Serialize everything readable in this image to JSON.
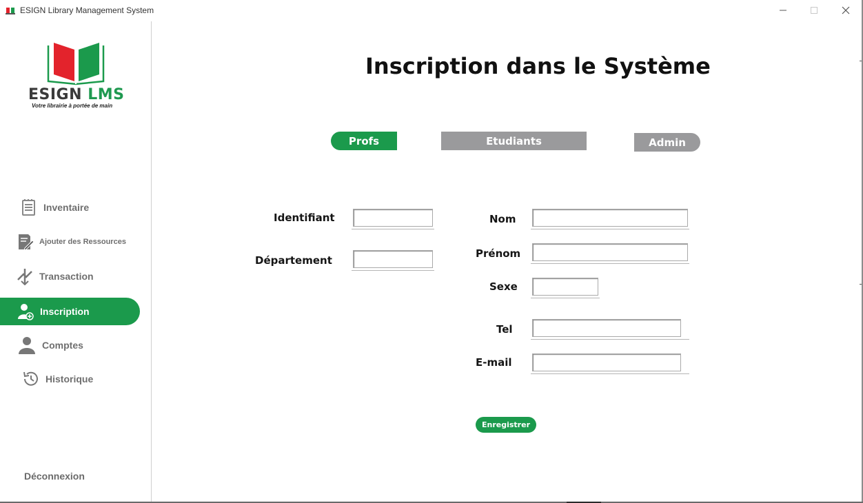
{
  "window": {
    "title": "ESIGN Library Management System"
  },
  "brand": {
    "name_part1": "ESIGN",
    "name_part2": "LMS",
    "tagline": "Votre librairie à portée de main",
    "colors": {
      "green": "#1b9a4c",
      "red": "#e3232c",
      "gray": "#3a3a3a"
    }
  },
  "sidebar": {
    "items": [
      {
        "label": "Inventaire",
        "icon": "document-list-icon",
        "active": false
      },
      {
        "label": "Ajouter des Ressources",
        "icon": "edit-document-icon",
        "active": false
      },
      {
        "label": "Transaction",
        "icon": "transfer-arrows-icon",
        "active": false
      },
      {
        "label": "Inscription",
        "icon": "add-user-icon",
        "active": true
      },
      {
        "label": "Comptes",
        "icon": "user-icon",
        "active": false
      },
      {
        "label": "Historique",
        "icon": "history-clock-icon",
        "active": false
      }
    ],
    "logout_label": "Déconnexion"
  },
  "main": {
    "title": "Inscription dans le Système",
    "tabs": [
      {
        "label": "Profs",
        "active": true
      },
      {
        "label": "Etudiants",
        "active": false
      },
      {
        "label": "Admin",
        "active": false
      }
    ],
    "form": {
      "identifiant": {
        "label": "Identifiant",
        "value": ""
      },
      "departement": {
        "label": "Département",
        "value": ""
      },
      "nom": {
        "label": "Nom",
        "value": ""
      },
      "prenom": {
        "label": "Prénom",
        "value": ""
      },
      "sexe": {
        "label": "Sexe",
        "value": ""
      },
      "tel": {
        "label": "Tel",
        "value": ""
      },
      "email": {
        "label": "E-mail",
        "value": ""
      }
    },
    "save_label": "Enregistrer"
  }
}
